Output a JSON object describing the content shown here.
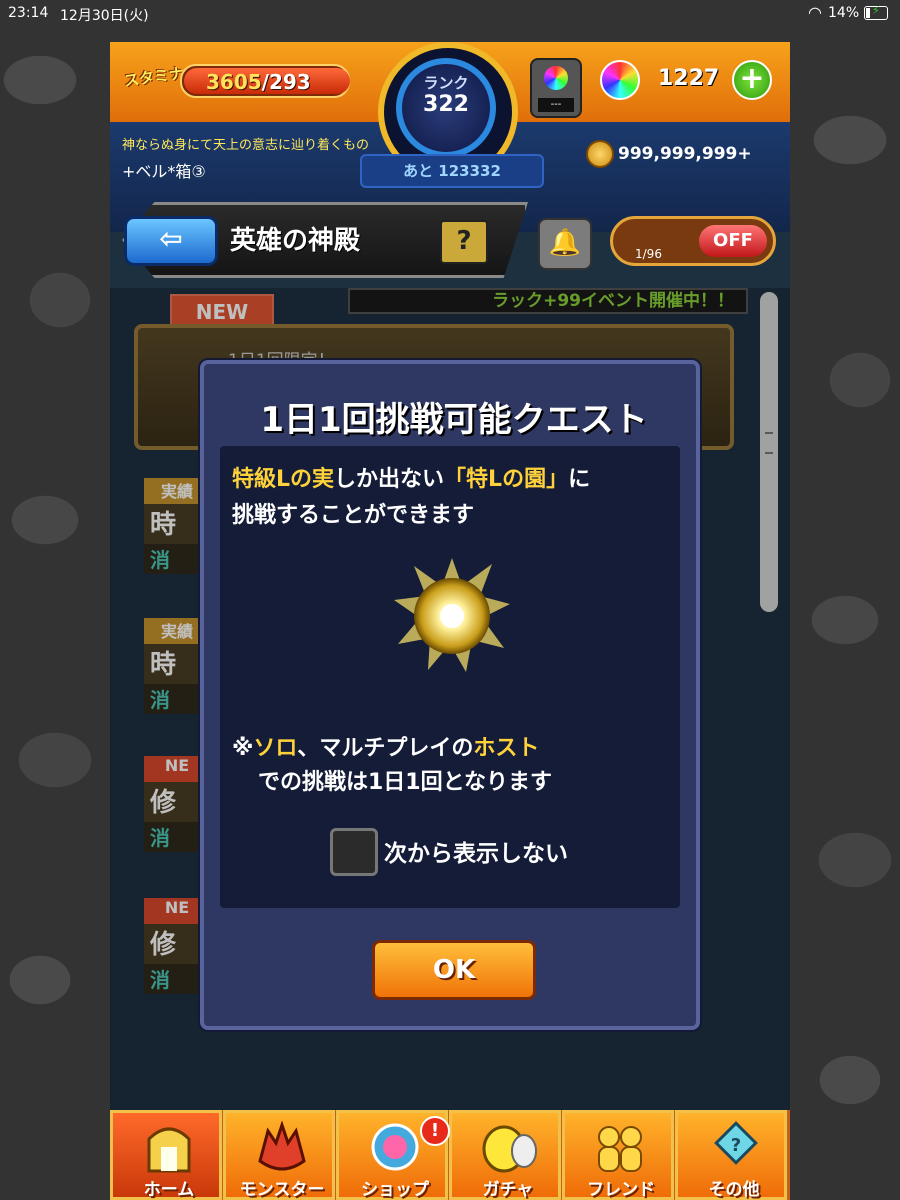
{
  "status_bar": {
    "time": "23:14",
    "date": "12月30日(火)",
    "battery": "14%"
  },
  "header": {
    "stamina_label": "スタミナ",
    "stamina_current": "3605",
    "stamina_max": "/293",
    "rank_label": "ランク",
    "rank_value": "322",
    "rank_next": "あと 123332",
    "orb_slot": "---",
    "gem_count": "1227",
    "player_title": "神ならぬ身にて天上の意志に辿り着くもの",
    "player_name": "+ベル*箱③",
    "coin_count": "999,999,999+"
  },
  "nav": {
    "back_icon": "back-arrow-icon",
    "title": "英雄の神殿",
    "help_label": "?",
    "bell_icon": "bell-icon",
    "auto_count": "1/96",
    "auto_label": "OFF"
  },
  "content": {
    "new_tag": "NEW",
    "event_banner": "ラック+99イベント開催中！！",
    "first_card_text": "1日1回限定！",
    "side_items": [
      {
        "tag": "実績",
        "big": "時",
        "small": "消"
      },
      {
        "tag": "実績",
        "big": "時",
        "small": "消"
      },
      {
        "tag": "NE",
        "big": "修",
        "small": "消"
      },
      {
        "tag": "NE",
        "big": "修",
        "small": "消"
      }
    ]
  },
  "dialog": {
    "title": "1日1回挑戦可能クエスト",
    "desc_hl1": "特級Lの実",
    "desc_part1": "しか出ない",
    "desc_hl2": "「特Lの園」",
    "desc_part2": "に",
    "desc_line2": "挑戦することができます",
    "note_prefix": "※",
    "note_hl1": "ソロ",
    "note_part1": "、マルチプレイの",
    "note_hl2": "ホスト",
    "note_line2": "での挑戦は1日1回となります",
    "checkbox_label": "次から表示しない",
    "ok_label": "OK"
  },
  "bottom_nav": [
    {
      "label": "ホーム",
      "icon": "home-gate-icon"
    },
    {
      "label": "モンスター",
      "icon": "monster-icon"
    },
    {
      "label": "ショップ",
      "icon": "orb-shop-icon"
    },
    {
      "label": "ガチャ",
      "icon": "gacha-icon"
    },
    {
      "label": "フレンド",
      "icon": "friend-icon"
    },
    {
      "label": "その他",
      "icon": "other-icon"
    }
  ],
  "shop_badge": "!",
  "colors": {
    "accent_orange": "#f07308",
    "dialog_bg": "#2e3863",
    "highlight": "#ffd23a"
  }
}
